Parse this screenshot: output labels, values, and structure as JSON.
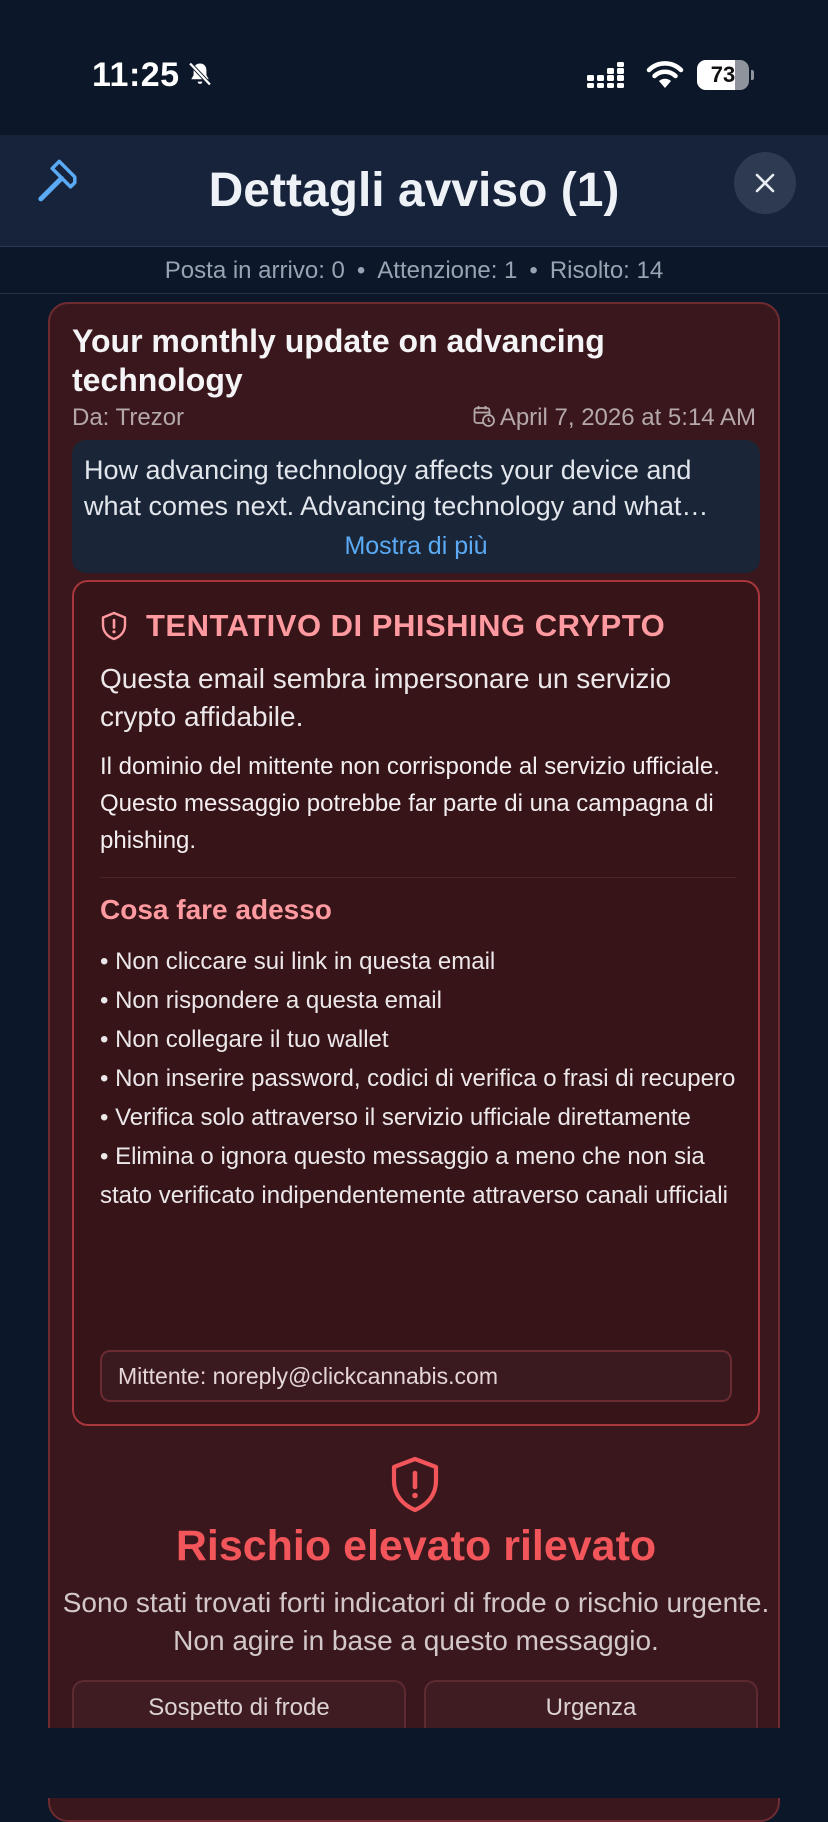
{
  "status_bar": {
    "time": "11:25",
    "battery_level": "73",
    "battery_fraction": 0.73
  },
  "nav": {
    "title": "Dettagli avviso (1)",
    "left_icon": "hammer-icon",
    "close_icon": "close-icon"
  },
  "counts": {
    "inbox": "Posta in arrivo: 0",
    "attention": "Attenzione: 1",
    "resolved": "Risolto: 14",
    "separator": "•"
  },
  "email": {
    "subject": "Your monthly update on advancing technology",
    "from": "Da: Trezor",
    "date": "April 7, 2026 at 5:14 AM",
    "preview": "How advancing technology affects your device and what comes next.  Advancing technology and what comes next for the devices you rely on every day",
    "show_more": "Mostra di più"
  },
  "warning": {
    "heading": "TENTATIVO DI PHISHING CRYPTO",
    "lead": "Questa email sembra impersonare un servizio crypto affidabile.",
    "detail": "Il dominio del mittente non corrisponde al servizio ufficiale. Questo messaggio potrebbe far parte di una campagna di phishing.",
    "todo_title": "Cosa fare adesso",
    "todo_items": [
      "• Non cliccare sui link in questa email",
      "• Non rispondere a questa email",
      "• Non collegare il tuo wallet",
      "• Non inserire password, codici di verifica o frasi di recupero",
      "• Verifica solo attraverso il servizio ufficiale direttamente",
      "• Elimina o ignora questo messaggio a meno che non sia stato verificato indipendentemente attraverso canali ufficiali"
    ],
    "sender": "Mittente: noreply@clickcannabis.com"
  },
  "risk": {
    "title": "Rischio elevato rilevato",
    "description": "Sono stati trovati forti indicatori di frode o rischio urgente. Non agire in base a questo messaggio.",
    "tags": [
      "Sospetto di frode",
      "Urgenza"
    ]
  },
  "colors": {
    "background": "#0c1729",
    "card": "#3a171c",
    "accent_red": "#f2555a",
    "link_blue": "#5aaaf5"
  }
}
